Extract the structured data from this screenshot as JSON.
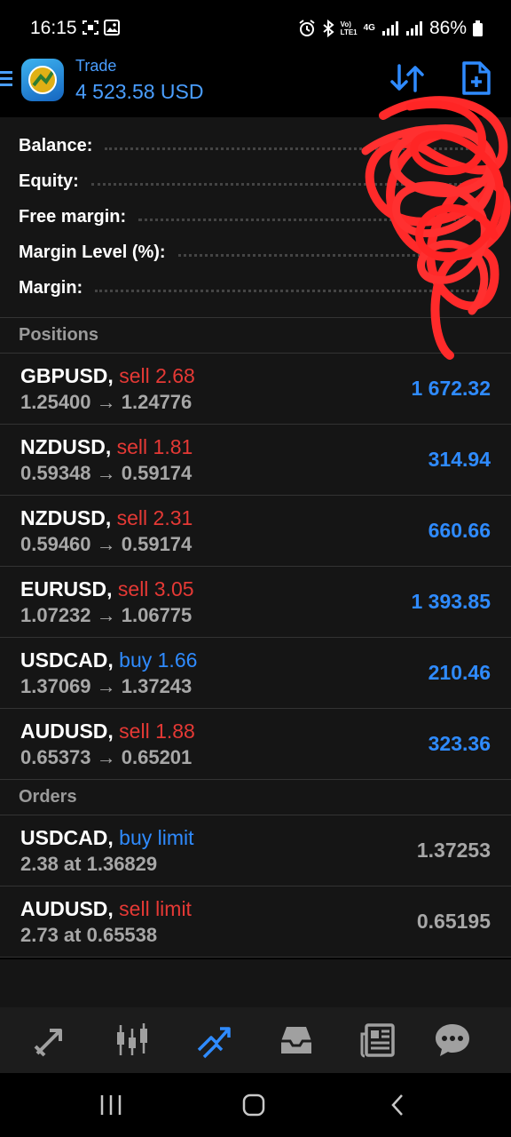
{
  "status_bar": {
    "time": "16:15",
    "left_icons": [
      "screenshot-icon",
      "gallery-icon"
    ],
    "network_label_top": "Vo)",
    "network_label_bottom": "LTE1",
    "network_type": "4G",
    "battery": "86%"
  },
  "header": {
    "title": "Trade",
    "balance": "4 523.58 USD"
  },
  "account_summary": [
    {
      "label": "Balance:",
      "value": ""
    },
    {
      "label": "Equity:",
      "value": ""
    },
    {
      "label": "Free margin:",
      "value": ""
    },
    {
      "label": "Margin Level (%):",
      "value": ""
    },
    {
      "label": "Margin:",
      "value": ""
    }
  ],
  "positions_title": "Positions",
  "positions": [
    {
      "symbol": "GBPUSD,",
      "side": "sell 2.68",
      "type": "sell",
      "prices": "1.25400 → 1.24776",
      "profit": "1 672.32"
    },
    {
      "symbol": "NZDUSD,",
      "side": "sell 1.81",
      "type": "sell",
      "prices": "0.59348 → 0.59174",
      "profit": "314.94"
    },
    {
      "symbol": "NZDUSD,",
      "side": "sell 2.31",
      "type": "sell",
      "prices": "0.59460 → 0.59174",
      "profit": "660.66"
    },
    {
      "symbol": "EURUSD,",
      "side": "sell 3.05",
      "type": "sell",
      "prices": "1.07232 → 1.06775",
      "profit": "1 393.85"
    },
    {
      "symbol": "USDCAD,",
      "side": "buy 1.66",
      "type": "buy",
      "prices": "1.37069 → 1.37243",
      "profit": "210.46"
    },
    {
      "symbol": "AUDUSD,",
      "side": "sell 1.88",
      "type": "sell",
      "prices": "0.65373 → 0.65201",
      "profit": "323.36"
    }
  ],
  "orders_title": "Orders",
  "orders": [
    {
      "symbol": "USDCAD,",
      "side": "buy limit",
      "type": "buy",
      "details": "2.38 at 1.36829",
      "price": "1.37253"
    },
    {
      "symbol": "AUDUSD,",
      "side": "sell limit",
      "type": "sell",
      "details": "2.73 at 0.65538",
      "price": "0.65195"
    }
  ],
  "bottom_nav": [
    "quotes-icon",
    "chart-icon",
    "trade-icon",
    "history-icon",
    "news-icon",
    "messages-icon"
  ],
  "colors": {
    "blue": "#2f8bff",
    "red": "#e53935",
    "background": "#151515",
    "scribble": "#ff2a2a"
  }
}
